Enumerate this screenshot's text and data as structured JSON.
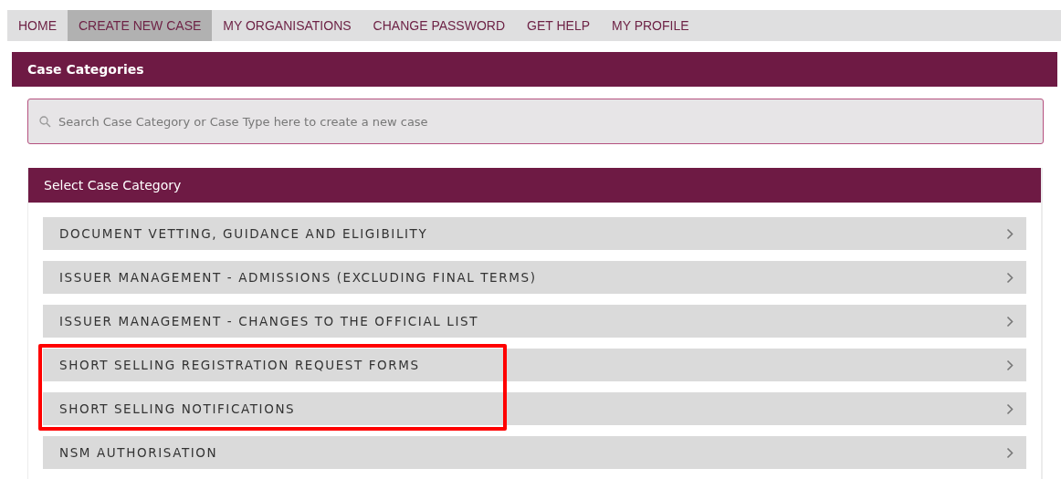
{
  "nav": [
    {
      "label": "HOME",
      "selected": false
    },
    {
      "label": "CREATE NEW CASE",
      "selected": true
    },
    {
      "label": "MY ORGANISATIONS",
      "selected": false
    },
    {
      "label": "CHANGE PASSWORD",
      "selected": false
    },
    {
      "label": "GET HELP",
      "selected": false
    },
    {
      "label": "MY PROFILE",
      "selected": false
    }
  ],
  "section": {
    "title": "Case Categories"
  },
  "search": {
    "placeholder": "Search Case Category or Case Type here to create a new case"
  },
  "panel": {
    "title": "Select Case Category",
    "items": [
      {
        "label": "DOCUMENT VETTING, GUIDANCE AND ELIGIBILITY",
        "highlighted": false
      },
      {
        "label": "ISSUER MANAGEMENT - ADMISSIONS (EXCLUDING FINAL TERMS)",
        "highlighted": false
      },
      {
        "label": "ISSUER MANAGEMENT - CHANGES TO THE OFFICIAL LIST",
        "highlighted": false
      },
      {
        "label": "SHORT SELLING REGISTRATION REQUEST FORMS",
        "highlighted": true
      },
      {
        "label": "SHORT SELLING NOTIFICATIONS",
        "highlighted": true
      },
      {
        "label": "NSM AUTHORISATION",
        "highlighted": false
      }
    ]
  }
}
